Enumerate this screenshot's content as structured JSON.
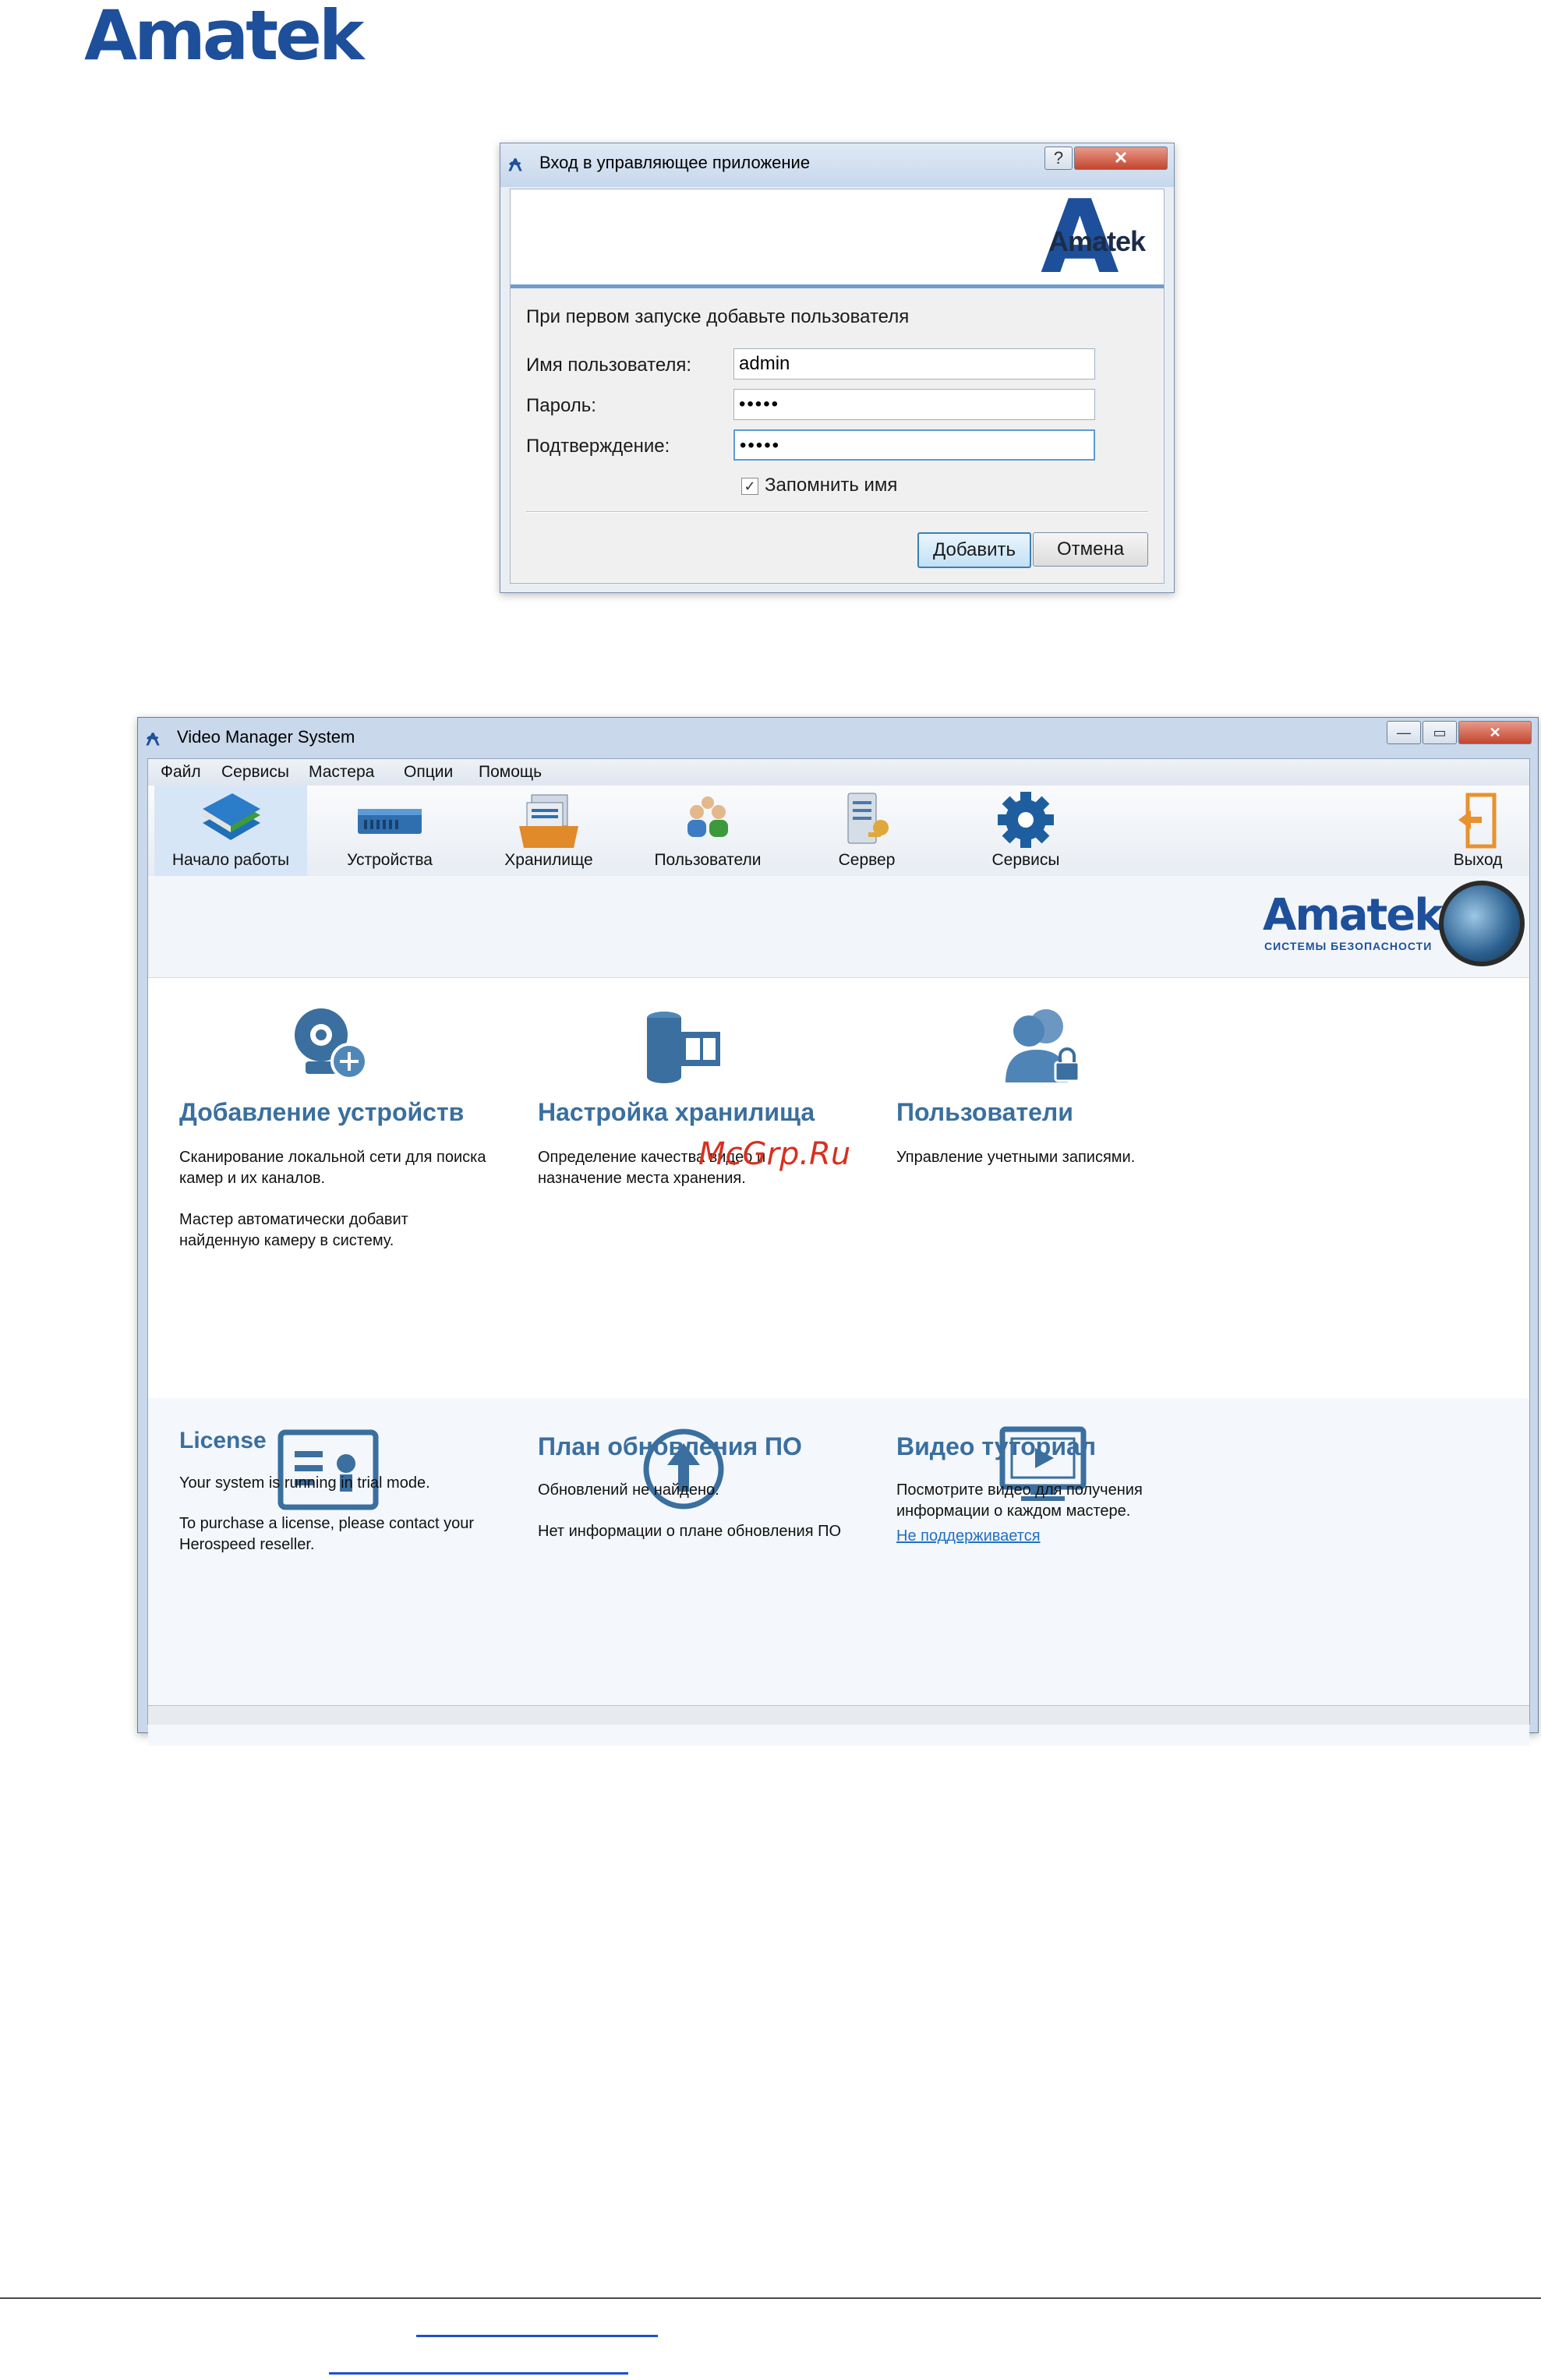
{
  "page_logo": "Amatek",
  "login_dialog": {
    "title": "Вход в управляющее приложение",
    "help_button": "?",
    "close_button": "✕",
    "logo_letter": "A",
    "logo_text": "Amatek",
    "instruction": "При первом запуске добавьте пользователя",
    "username_label": "Имя пользователя:",
    "username_value": "admin",
    "password_label": "Пароль:",
    "password_value": "•••••",
    "confirm_label": "Подтверждение:",
    "confirm_value": "•••••",
    "remember_checked": true,
    "remember_label": "Запомнить имя",
    "add_button": "Добавить",
    "cancel_button": "Отмена"
  },
  "main_window": {
    "title": "Video Manager System",
    "window_buttons": {
      "minimize": "—",
      "maximize": "▭",
      "close": "✕"
    },
    "menu": [
      "Файл",
      "Сервисы",
      "Мастера",
      "Опции",
      "Помощь"
    ],
    "toolbar": [
      {
        "label": "Начало работы",
        "icon": "books-icon",
        "active": true
      },
      {
        "label": "Устройства",
        "icon": "dvr-device-icon",
        "active": false
      },
      {
        "label": "Хранилище",
        "icon": "storage-tray-icon",
        "active": false
      },
      {
        "label": "Пользователи",
        "icon": "users-icon",
        "active": false
      },
      {
        "label": "Сервер",
        "icon": "server-key-icon",
        "active": false
      },
      {
        "label": "Сервисы",
        "icon": "gear-icon",
        "active": false
      },
      {
        "label": "Выход",
        "icon": "exit-door-icon",
        "active": false
      }
    ],
    "brand": {
      "name": "Amatek",
      "subtitle": "СИСТЕМЫ БЕЗОПАСНОСТИ"
    },
    "cards": {
      "add_devices": {
        "title": "Добавление устройств",
        "p1": "Сканирование локальной сети для поиска камер и их каналов.",
        "p2": "Мастер автоматически добавит найденную камеру в систему."
      },
      "storage": {
        "title": "Настройка хранилища",
        "p1": "Определение качества видео и назначение места хранения."
      },
      "users": {
        "title": "Пользователи",
        "p1": "Управление учетными записями."
      },
      "license": {
        "title": "License",
        "p1": "Your system is running in trial mode.",
        "p2": "To purchase a license, please contact your Herospeed reseller."
      },
      "update": {
        "title": "План обновления ПО",
        "p1": "Обновлений не найдено.",
        "p2": "Нет информации о плане обновления ПО"
      },
      "video": {
        "title": "Видео туториал",
        "p1": "Посмотрите видео для получения информации о каждом мастере.",
        "link": "Не поддерживается"
      }
    },
    "watermark": "McGrp.Ru"
  },
  "colors": {
    "brand_blue": "#1d4f9b",
    "card_title": "#3a6f9f",
    "link": "#1f6fc6",
    "footer_link": "#1f4fcf"
  }
}
